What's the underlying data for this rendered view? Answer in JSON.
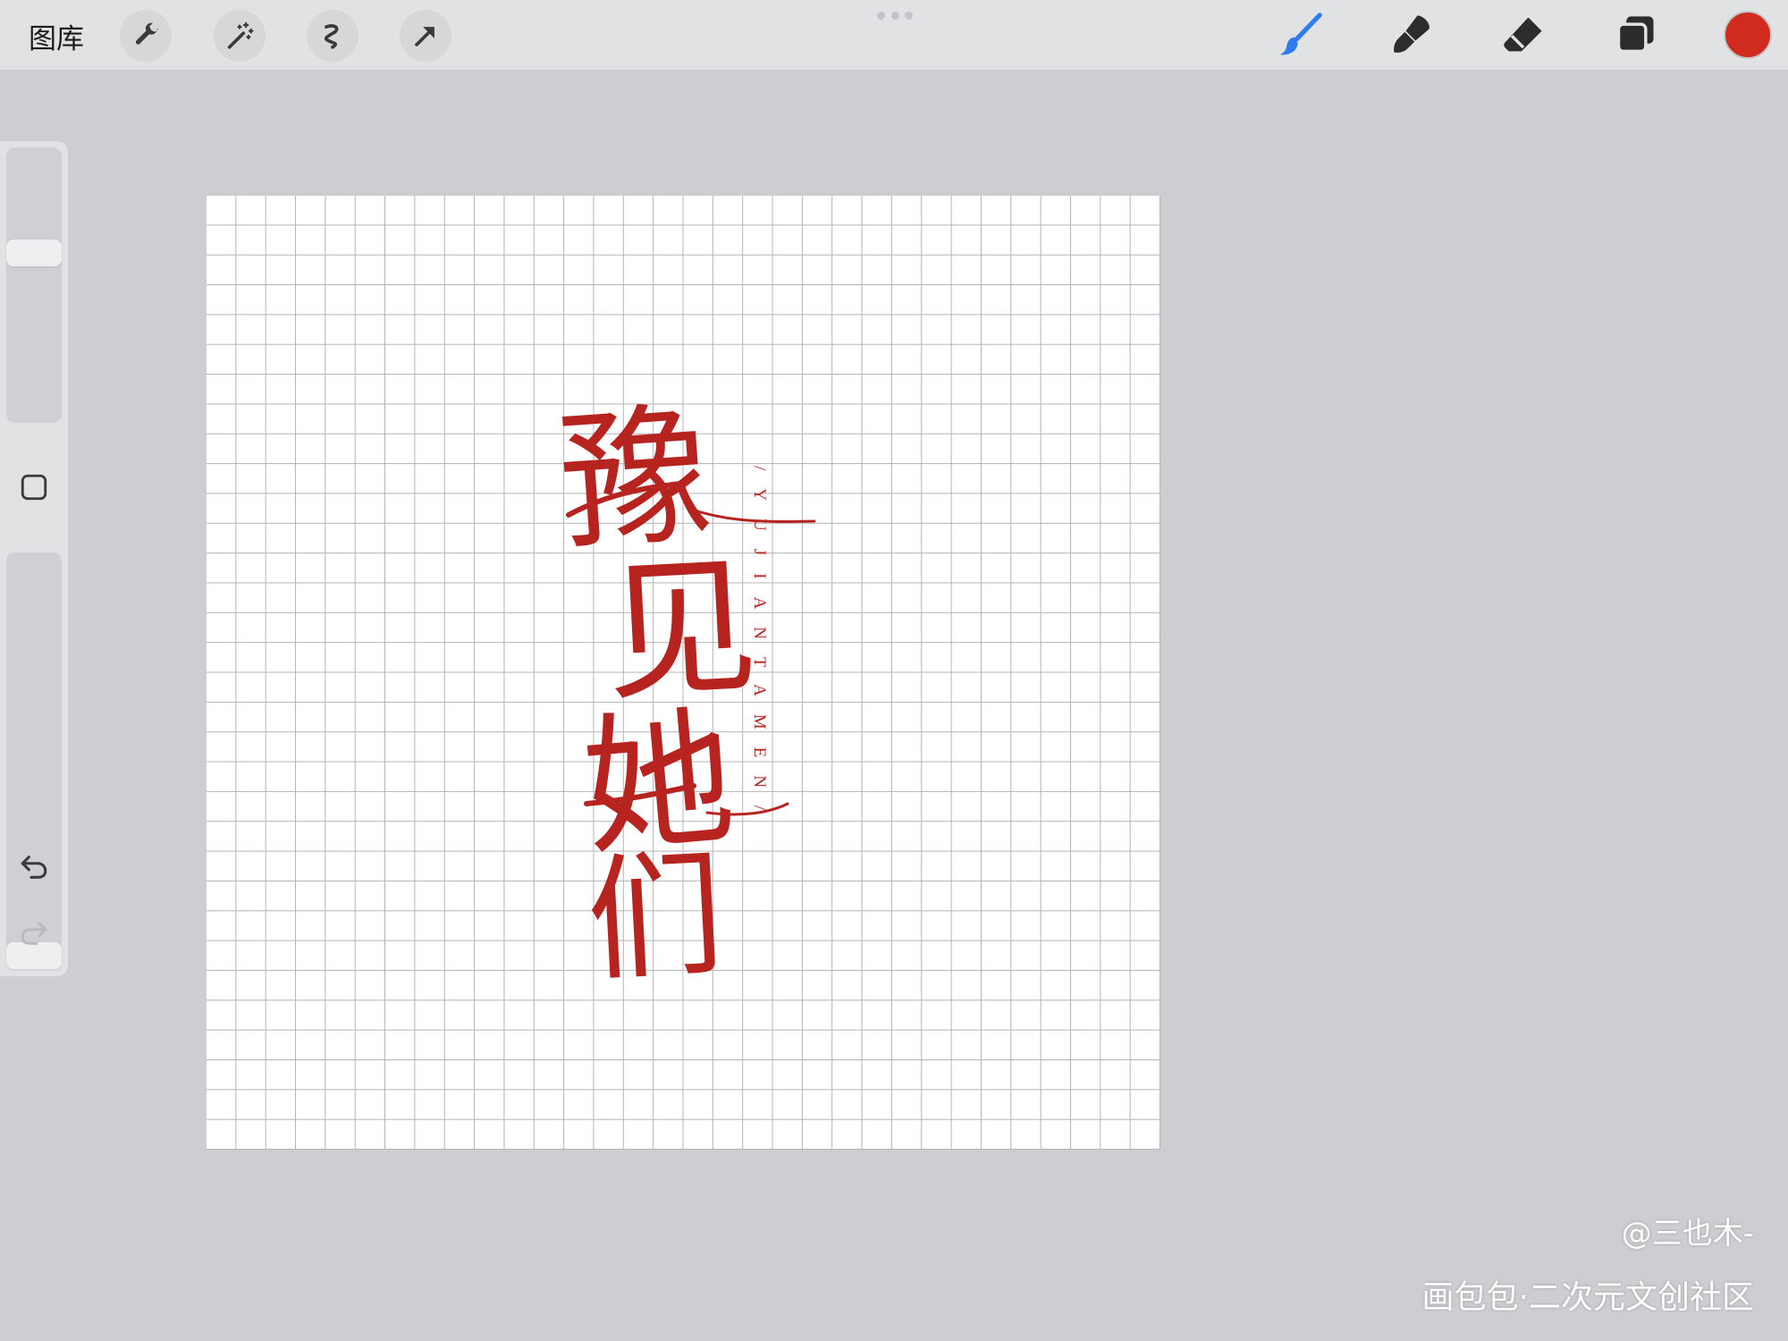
{
  "toolbar": {
    "gallery_label": "图库",
    "left_tools": [
      {
        "icon": "wrench-icon",
        "label": "actions"
      },
      {
        "icon": "magic-wand-icon",
        "label": "adjustments"
      },
      {
        "icon": "selection-icon",
        "label": "selection"
      },
      {
        "icon": "transform-arrow-icon",
        "label": "transform"
      }
    ],
    "right_tools": [
      {
        "icon": "brush-icon",
        "active": true,
        "color": "#2f7bf0"
      },
      {
        "icon": "smudge-icon",
        "active": false
      },
      {
        "icon": "eraser-icon",
        "active": false
      },
      {
        "icon": "layers-icon",
        "active": false
      }
    ],
    "current_color": "#d12a1f"
  },
  "sidebar": {
    "brush_size_level": 0.63,
    "opacity_level": 0.0,
    "undo_icon": "undo-arrow-icon",
    "redo_icon": "redo-arrow-icon"
  },
  "canvas": {
    "artwork_chars": [
      "豫",
      "见",
      "她",
      "们"
    ],
    "pinyin_vertical": "/YUJIANTAMEN/",
    "ink_color": "#b72420"
  },
  "watermark": {
    "author": "@三也木-",
    "site": "画包包·二次元文创社区"
  }
}
